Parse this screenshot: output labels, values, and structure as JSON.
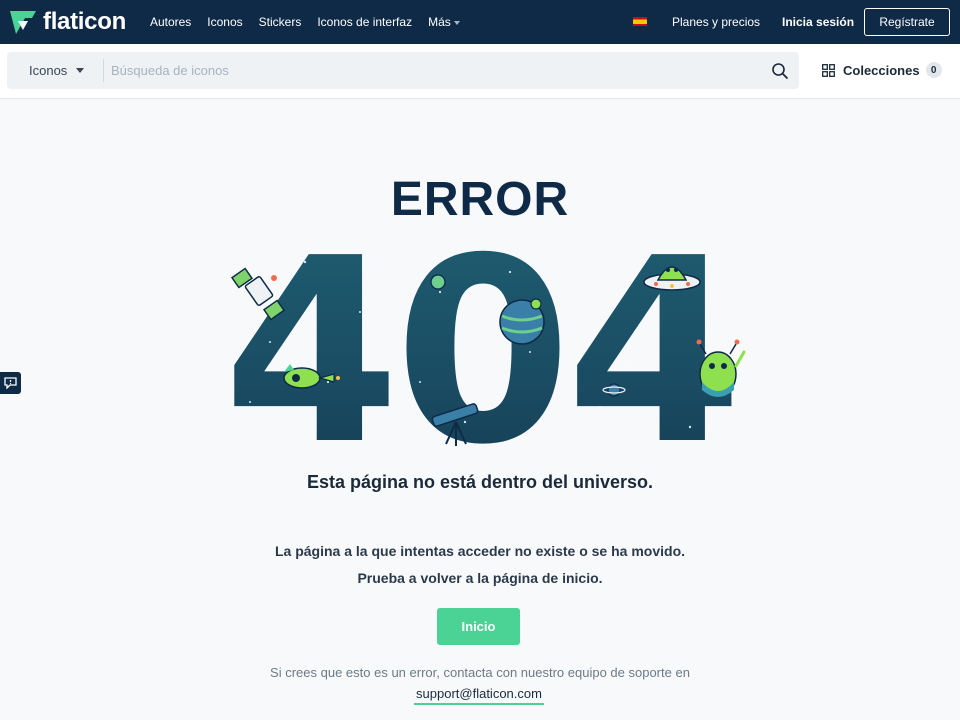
{
  "brand": {
    "name": "flaticon",
    "accent": "#4ad395",
    "navy": "#0e2a47"
  },
  "nav": {
    "items": [
      {
        "label": "Autores"
      },
      {
        "label": "Iconos"
      },
      {
        "label": "Stickers"
      },
      {
        "label": "Iconos de interfaz"
      },
      {
        "label": "Más"
      }
    ],
    "language_flag": "spain-flag-icon",
    "plans_label": "Planes y precios",
    "login_label": "Inicia sesión",
    "signup_label": "Regístrate"
  },
  "search": {
    "type_label": "Iconos",
    "placeholder": "Búsqueda de iconos",
    "value": "",
    "collections_label": "Colecciones",
    "collections_count": "0"
  },
  "error": {
    "title": "ERROR",
    "code": "404",
    "headline": "Esta página no está dentro del universo.",
    "message_line1": "La página a la que intentas acceder no existe o se ha movido.",
    "message_line2": "Prueba a volver a la página de inicio.",
    "home_button": "Inicio",
    "support_text": "Si crees que esto es un error, contacta con nuestro equipo de soporte en",
    "support_email": "support@flaticon.com"
  }
}
